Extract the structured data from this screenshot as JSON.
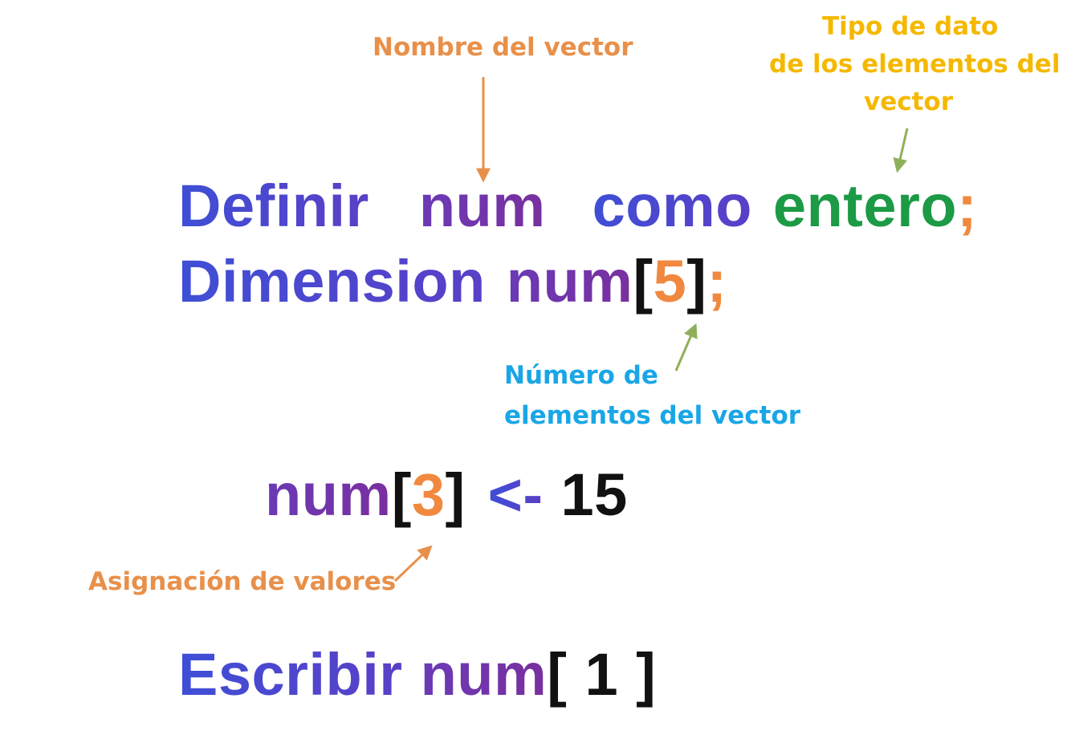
{
  "annotations": {
    "array_name": "Nombre del vector",
    "element_type_line1": "Tipo de dato",
    "element_type_line2": "de los elementos del",
    "element_type_line3": "vector",
    "element_count_line1": "Número de",
    "element_count_line2": "elementos del vector",
    "assignment": "Asignación de valores"
  },
  "code": {
    "line1": {
      "keyword": "Definir",
      "name": "num",
      "as": "como",
      "type": "entero",
      "terminator": ";"
    },
    "line2": {
      "keyword": "Dimension",
      "name": "num",
      "open": "[",
      "size": "5",
      "close": "]",
      "terminator": ";"
    },
    "line3": {
      "name": "num",
      "open": "[",
      "index": "3",
      "close": "]",
      "operator": "<-",
      "value": "15"
    },
    "line4": {
      "keyword": "Escribir",
      "name": "num",
      "open": "[",
      "index": "1",
      "close": "]"
    }
  },
  "colors": {
    "orange_label": "#e8904a",
    "yellow_label": "#f5b800",
    "cyan_label": "#19a6e6",
    "green_arrow": "#8fb05a",
    "keyword_blue": "#3f4fd6",
    "variable_purple": "#6a3ab6",
    "type_green": "#1c9a45"
  }
}
